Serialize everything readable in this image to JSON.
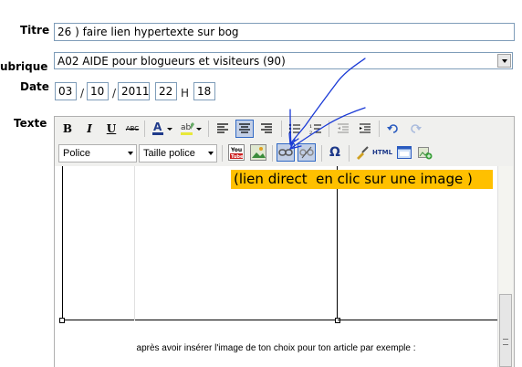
{
  "form": {
    "titre_label": "Titre",
    "titre_value": "26 ) faire lien hypertexte sur bog",
    "rubrique_label": "ubrique",
    "rubrique_value": "A02 AIDE pour blogueurs et visiteurs (90)",
    "date_label": "Date",
    "date_day": "03",
    "date_month": "10",
    "date_year": "2011",
    "date_hour": "22",
    "date_min": "18",
    "date_sep": "/",
    "date_h": "H",
    "texte_label": "Texte"
  },
  "toolbar": {
    "bold": "B",
    "italic": "I",
    "underline": "U",
    "strike": "ABC",
    "html": "HTML",
    "omega": "Ω",
    "font_select": "Police",
    "size_select": "Taille police"
  },
  "editor": {
    "highlight_text": "(lien direct  en clic sur une image )",
    "bottom_text": "après avoir insérer l'image de ton choix pour ton article par exemple :",
    "highlight_color": "#ffc000"
  },
  "icons": [
    "bold-icon",
    "italic-icon",
    "underline-icon",
    "strikethrough-icon",
    "text-color-icon",
    "highlight-color-icon",
    "align-left-icon",
    "align-center-icon",
    "align-right-icon",
    "bullet-list-icon",
    "numbered-list-icon",
    "outdent-icon",
    "indent-icon",
    "undo-icon",
    "redo-icon",
    "youtube-icon",
    "image-icon",
    "link-icon",
    "unlink-icon",
    "special-char-icon",
    "cleanup-icon",
    "html-icon",
    "preview-icon",
    "insert-media-icon"
  ]
}
